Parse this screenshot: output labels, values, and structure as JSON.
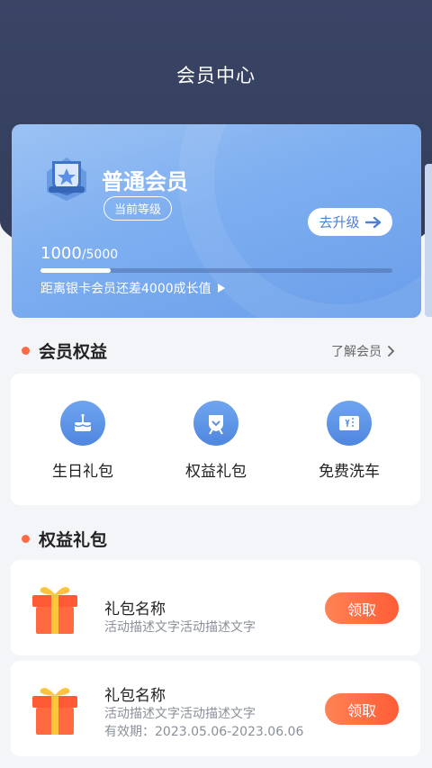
{
  "header": {
    "title": "会员中心"
  },
  "member_card": {
    "level_name": "普通会员",
    "level_tag": "当前等级",
    "upgrade_label": "去升级",
    "progress_current": "1000",
    "progress_total": "/5000",
    "progress_fraction": 0.2,
    "gap_text": "距离银卡会员还差4000成长值"
  },
  "benefits": {
    "title": "会员权益",
    "more_label": "了解会员",
    "items": [
      {
        "label": "生日礼包",
        "icon": "cake-icon"
      },
      {
        "label": "权益礼包",
        "icon": "medal-icon"
      },
      {
        "label": "免费洗车",
        "icon": "ticket-icon"
      }
    ]
  },
  "gifts": {
    "title": "权益礼包",
    "items": [
      {
        "name": "礼包名称",
        "desc": "活动描述文字活动描述文字",
        "validity": "",
        "button": "领取"
      },
      {
        "name": "礼包名称",
        "desc": "活动描述文字活动描述文字",
        "validity": "有效期：2023.05.06-2023.06.06",
        "button": "领取"
      }
    ]
  },
  "colors": {
    "header_bg": "#3a4566",
    "card_blue": "#7daef0",
    "accent_orange": "#ff6a42",
    "button_blue": "#4d7fd6"
  }
}
